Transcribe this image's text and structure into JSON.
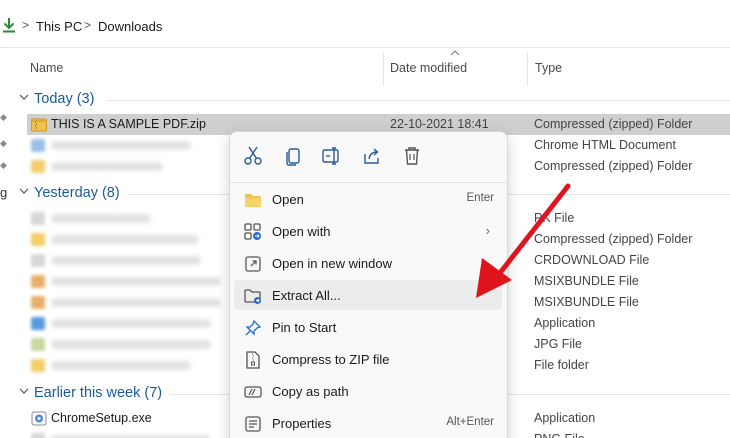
{
  "breadcrumb": {
    "items": [
      "This PC",
      "Downloads"
    ],
    "separator": ">"
  },
  "columns": {
    "name": "Name",
    "date": "Date modified",
    "type": "Type"
  },
  "groups": {
    "today": "Today (3)",
    "yesterday": "Yesterday (8)",
    "earlier": "Earlier this week (7)"
  },
  "files": {
    "selected": {
      "name": "THIS IS A SAMPLE PDF.zip",
      "date": "22-10-2021 18:41",
      "type": "Compressed (zipped) Folder"
    },
    "today_types": [
      "Chrome HTML Document",
      "Compressed (zipped) Folder"
    ],
    "yesterday_types": [
      "PK File",
      "Compressed (zipped) Folder",
      "CRDOWNLOAD File",
      "MSIXBUNDLE File",
      "MSIXBUNDLE File",
      "Application",
      "JPG File",
      "File folder"
    ],
    "earlier_first": {
      "name": "ChromeSetup.exe",
      "type": "Application"
    },
    "earlier_second_type": "PNG File"
  },
  "left_edge_text": "g",
  "context_menu": {
    "quick_actions": [
      "cut-icon",
      "copy-icon",
      "rename-icon",
      "share-icon",
      "delete-icon"
    ],
    "items": [
      {
        "label": "Open",
        "shortcut": "Enter"
      },
      {
        "label": "Open with",
        "submenu": "›"
      },
      {
        "label": "Open in new window"
      },
      {
        "label": "Extract All..."
      },
      {
        "label": "Pin to Start"
      },
      {
        "label": "Compress to ZIP file"
      },
      {
        "label": "Copy as path"
      },
      {
        "label": "Properties",
        "shortcut": "Alt+Enter"
      }
    ]
  },
  "colors": {
    "accent": "#1a5a9c",
    "selection": "#cfcfcf",
    "arrow": "#e0141c"
  }
}
